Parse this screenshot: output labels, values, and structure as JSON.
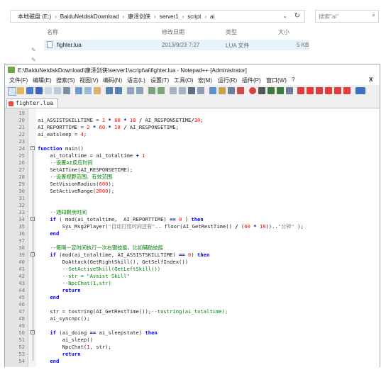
{
  "explorer": {
    "breadcrumb": [
      "本地磁盘 (E:)",
      "BaiduNetdiskDownload",
      "康泽剑侠",
      "server1",
      "script",
      "ai"
    ],
    "search_placeholder": "搜索\"ai\"",
    "columns": [
      "名称",
      "修改日期",
      "类型",
      "大小"
    ],
    "file": {
      "name": "fighter.lua",
      "date": "2013/9/23 7:27",
      "type": "LUA 文件",
      "size": "5 KB"
    }
  },
  "npp": {
    "title": "E:\\BaiduNetdiskDownload\\康泽剑侠\\server1\\script\\ai\\fighter.lua - Notepad++ [Administrator]",
    "menu": [
      "文件(F)",
      "编辑(E)",
      "搜索(S)",
      "视图(V)",
      "编码(N)",
      "语言(L)",
      "设置(T)",
      "工具(O)",
      "宏(M)",
      "运行(R)",
      "插件(P)",
      "窗口(W)",
      "?"
    ],
    "tab_label": "fighter.lua",
    "lines": [
      {
        "n": "19",
        "t": ""
      },
      {
        "n": "20",
        "t": "ai_ASSISTSKILLTIME = 1 * 60 * 18 / AI_RESPONSETIME/30;"
      },
      {
        "n": "21",
        "t": "AI_REPORTTIME = 2 * 60 * 18 / AI_RESPONSETIME;"
      },
      {
        "n": "22",
        "t": "ai_eatsleep = 4;"
      },
      {
        "n": "23",
        "t": ""
      },
      {
        "n": "24",
        "t": "function main()"
      },
      {
        "n": "25",
        "t": "    ai_totaltime = ai_totaltime + 1"
      },
      {
        "n": "26",
        "t": "    --设置AI反应时间"
      },
      {
        "n": "27",
        "t": "    SetAITime(AI_RESPONSETIME);"
      },
      {
        "n": "28",
        "t": "    --设置视野范围、有效范围"
      },
      {
        "n": "29",
        "t": "    SetVisionRadius(600);"
      },
      {
        "n": "30",
        "t": "    SetActiveRange(2000);"
      },
      {
        "n": "31",
        "t": ""
      },
      {
        "n": "32",
        "t": ""
      },
      {
        "n": "33",
        "t": "    --通知剩余时间"
      },
      {
        "n": "34",
        "t": "    if ( mod(ai_totaltime,  AI_REPORTTIME) == 0 ) then"
      },
      {
        "n": "35",
        "t": "        Sys_Msg2Player(\"自动打怪时间还有\".. floor(AI_GetRestTime() / (60 * 18))..\"分钟\" );"
      },
      {
        "n": "36",
        "t": "    end"
      },
      {
        "n": "37",
        "t": ""
      },
      {
        "n": "38",
        "t": "    --每隔一定时间执行一次右键技能，比如辅助技能"
      },
      {
        "n": "39",
        "t": "    if (mod(ai_totaltime, AI_ASSISTSKILLTIME) == 0) then"
      },
      {
        "n": "40",
        "t": "        DoAttack(GetRightSkill(), GetSelfIndex())"
      },
      {
        "n": "41",
        "t": "        --SetActiveSkill(GetLeftSkill())"
      },
      {
        "n": "42",
        "t": "        --str = \"Assist Skill\""
      },
      {
        "n": "43",
        "t": "        --NpcChat(1,str)"
      },
      {
        "n": "44",
        "t": "        return"
      },
      {
        "n": "45",
        "t": "    end"
      },
      {
        "n": "46",
        "t": ""
      },
      {
        "n": "47",
        "t": "    str = tostring(AI_GetRestTime());--tostring(ai_totaltime);"
      },
      {
        "n": "48",
        "t": "    ai_syncnpc();"
      },
      {
        "n": "49",
        "t": ""
      },
      {
        "n": "50",
        "t": "    if (ai_doing == ai_sleepstate) then"
      },
      {
        "n": "51",
        "t": "        ai_sleep()"
      },
      {
        "n": "52",
        "t": "        NpcChat(1, str);"
      },
      {
        "n": "53",
        "t": "        return"
      },
      {
        "n": "54",
        "t": "    end"
      }
    ]
  },
  "colors": {
    "keyword": "#0000ff",
    "number": "#ff0000",
    "comment": "#008000",
    "string": "#808080",
    "selection": "#e5f3fb"
  }
}
